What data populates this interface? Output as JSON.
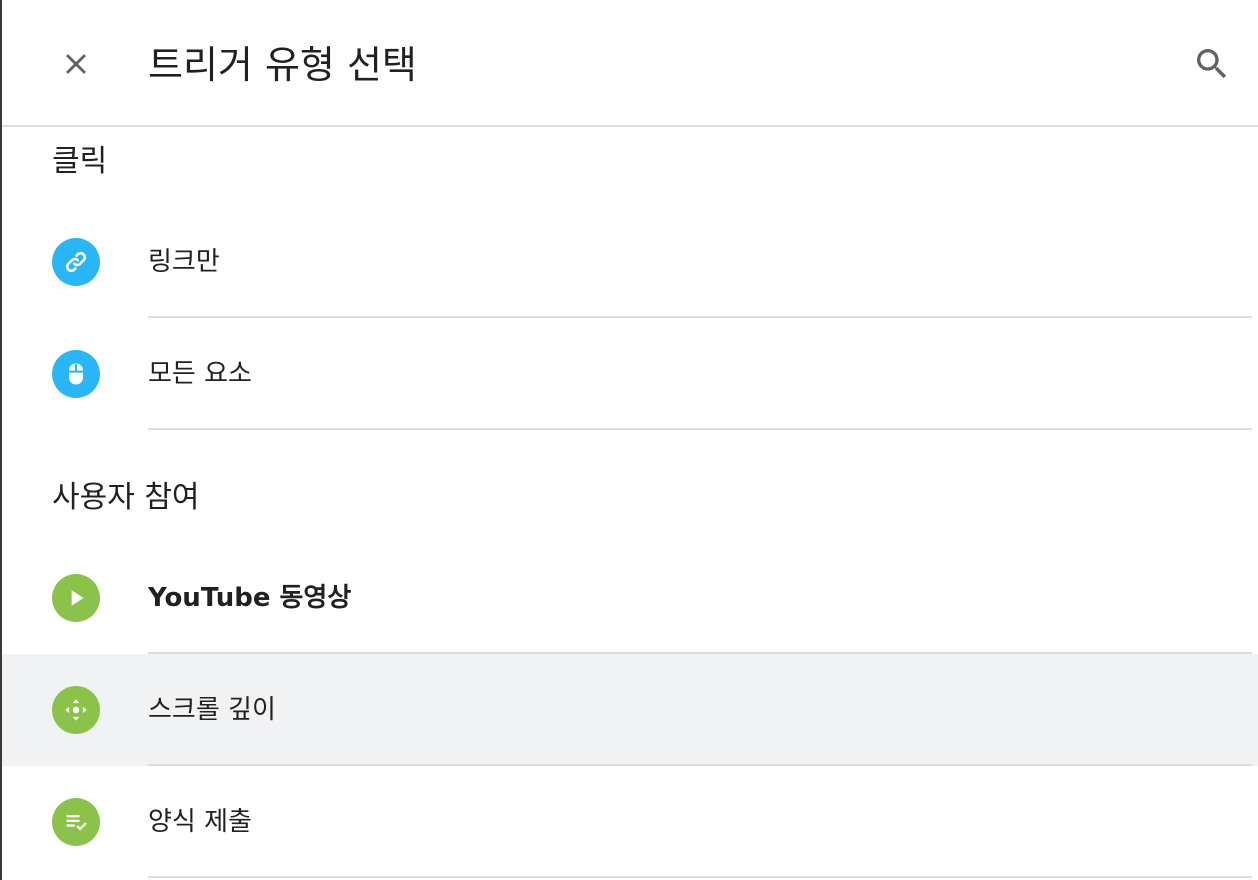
{
  "header": {
    "title": "트리거 유형 선택",
    "close_icon": "close-icon",
    "search_icon": "search-icon"
  },
  "sections": [
    {
      "label": "클릭",
      "items": [
        {
          "label": "링크만",
          "icon": "link-icon",
          "color": "#29b6f6",
          "bold": false
        },
        {
          "label": "모든 요소",
          "icon": "mouse-icon",
          "color": "#29b6f6",
          "bold": false
        }
      ]
    },
    {
      "label": "사용자 참여",
      "items": [
        {
          "label": "YouTube 동영상",
          "icon": "play-icon",
          "color": "#8bc34a",
          "bold": true
        },
        {
          "label": "스크롤 깊이",
          "icon": "scroll-arrows-icon",
          "color": "#8bc34a",
          "bold": false,
          "hovered": true
        },
        {
          "label": "양식 제출",
          "icon": "form-check-icon",
          "color": "#8bc34a",
          "bold": false
        }
      ]
    }
  ],
  "colors": {
    "click_accent": "#29b6f6",
    "engagement_accent": "#8bc34a",
    "hover_bg": "#f1f2f4",
    "divider": "#dcdcdc"
  }
}
